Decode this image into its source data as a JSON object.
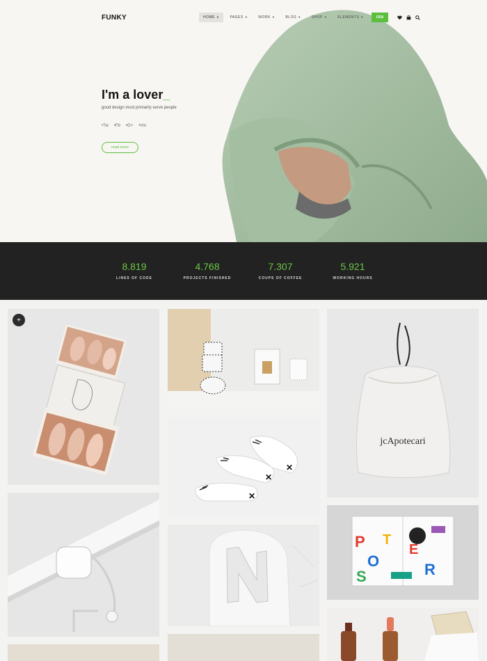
{
  "header": {
    "logo": "FUNKY",
    "nav": [
      {
        "label": "HOME"
      },
      {
        "label": "PAGES"
      },
      {
        "label": "WORK"
      },
      {
        "label": "BLOG"
      },
      {
        "label": "SHOP"
      },
      {
        "label": "ELEMENTS"
      }
    ],
    "cta": "USA",
    "icons": [
      "heart-icon",
      "bag-icon",
      "search-icon"
    ],
    "accent": "#5bbf3d"
  },
  "hero": {
    "title": "I'm a lover",
    "cursor": "_",
    "subtitle": "good design must primarily serve people",
    "socials": [
      "Tw",
      "Fb",
      "G+",
      "Vm"
    ],
    "button": "read more"
  },
  "stats": [
    {
      "value": "8.819",
      "label": "LINES OF CODE"
    },
    {
      "value": "4.768",
      "label": "PROJECTS FINISHED"
    },
    {
      "value": "7.307",
      "label": "COUPS OF COFFEE"
    },
    {
      "value": "5.921",
      "label": "WORKING HOURS"
    }
  ],
  "portfolio": {
    "toggle": "+",
    "bag_brand": "jcApotecari",
    "poster_text": [
      "P",
      "O",
      "S",
      "T",
      "E",
      "R"
    ]
  }
}
